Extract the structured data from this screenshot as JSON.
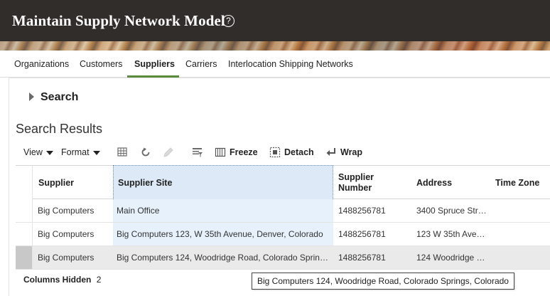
{
  "header": {
    "title": "Maintain Supply Network Model",
    "help_icon": "question-circle-icon"
  },
  "tabs": [
    {
      "label": "Organizations"
    },
    {
      "label": "Customers"
    },
    {
      "label": "Suppliers",
      "active": true
    },
    {
      "label": "Carriers"
    },
    {
      "label": "Interlocation Shipping Networks"
    }
  ],
  "search": {
    "label": "Search"
  },
  "results": {
    "title": "Search Results"
  },
  "toolbar": {
    "view": "View",
    "format": "Format",
    "freeze": "Freeze",
    "detach": "Detach",
    "wrap": "Wrap"
  },
  "table": {
    "columns": [
      "Supplier",
      "Supplier Site",
      "Supplier\nNumber",
      "Address",
      "Time Zone"
    ],
    "columns_display": {
      "supplier_number_line1": "Supplier",
      "supplier_number_line2": "Number"
    },
    "rows": [
      {
        "supplier": "Big Computers",
        "site": "Main Office",
        "number": "1488256781",
        "address": "3400 Spruce Str…"
      },
      {
        "supplier": "Big Computers",
        "site": "Big Computers 123, W 35th Avenue, Denver, Colorado",
        "number": "1488256781",
        "address": "123 W 35th Ave…"
      },
      {
        "supplier": "Big Computers",
        "site": "Big Computers 124, Woodridge Road, Colorado Sprin…",
        "number": "1488256781",
        "address": "124 Woodridge …"
      }
    ]
  },
  "footer": {
    "label": "Columns Hidden",
    "count": "2"
  },
  "tooltip": {
    "text": "Big Computers 124, Woodridge Road, Colorado Springs, Colorado"
  },
  "colors": {
    "header_bg": "#312d2a",
    "tab_active": "#5a8c3c",
    "selected_column": "#e6f1fb"
  }
}
